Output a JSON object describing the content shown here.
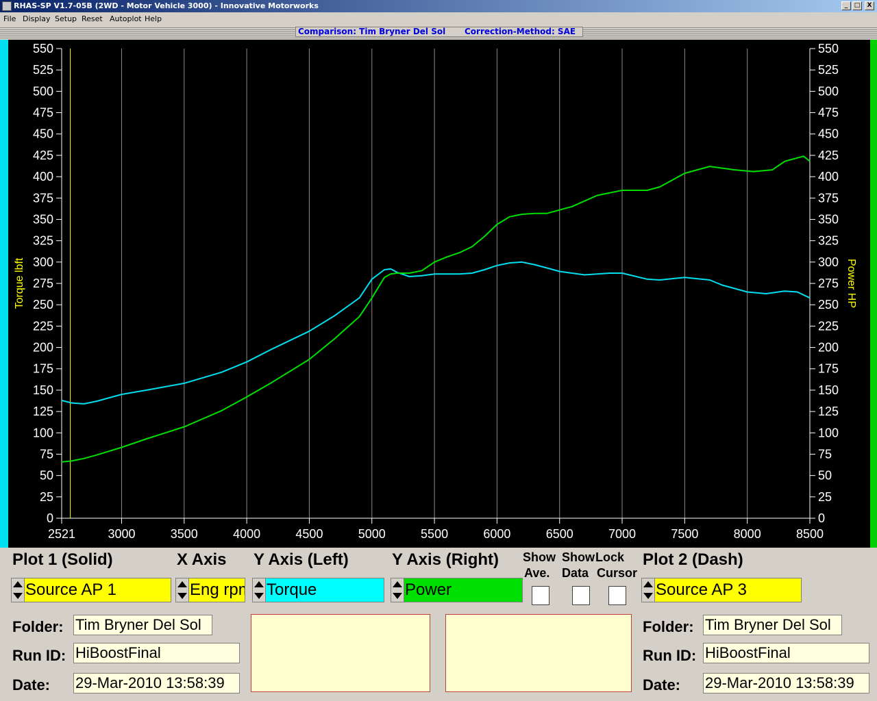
{
  "window": {
    "title": "RHAS-SP V1.7-05B  (2WD - Motor Vehicle 3000) - Innovative Motorworks",
    "controls": [
      "_",
      "□",
      "X"
    ]
  },
  "menu": [
    "File",
    "Display",
    "Setup",
    "Reset",
    "Autoplot",
    "Help"
  ],
  "header": {
    "comparison": "Comparison: Tim Bryner Del Sol",
    "correction": "Correction-Method: SAE"
  },
  "chart_data": {
    "type": "line",
    "xlabel": "",
    "ylabel_left": "Torque lbft",
    "ylabel_right": "Power HP",
    "xlim": [
      2521,
      8500
    ],
    "ylim": [
      0,
      550
    ],
    "x_ticks": [
      "2521",
      "3000",
      "3500",
      "4000",
      "4500",
      "5000",
      "5500",
      "6000",
      "6500",
      "7000",
      "7500",
      "8000",
      "8500"
    ],
    "y_ticks": [
      "0",
      "25",
      "50",
      "75",
      "100",
      "125",
      "150",
      "175",
      "200",
      "225",
      "250",
      "275",
      "300",
      "325",
      "350",
      "375",
      "400",
      "425",
      "450",
      "475",
      "500",
      "525",
      "550"
    ],
    "grid": true,
    "cursor_x": 2590,
    "series": [
      {
        "name": "Torque",
        "color": "#00e0f0",
        "x": [
          2521,
          2600,
          2700,
          2800,
          3000,
          3200,
          3500,
          3800,
          4000,
          4200,
          4500,
          4700,
          4900,
          5000,
          5100,
          5150,
          5200,
          5300,
          5400,
          5500,
          5600,
          5700,
          5800,
          5900,
          6000,
          6100,
          6200,
          6300,
          6400,
          6500,
          6700,
          6900,
          7000,
          7200,
          7300,
          7500,
          7700,
          7800,
          8000,
          8150,
          8300,
          8400,
          8500
        ],
        "values": [
          138,
          135,
          134,
          137,
          145,
          150,
          158,
          171,
          183,
          198,
          219,
          237,
          258,
          280,
          291,
          292,
          288,
          283,
          284,
          286,
          286,
          286,
          287,
          291,
          296,
          299,
          300,
          297,
          293,
          289,
          285,
          287,
          287,
          280,
          279,
          282,
          279,
          273,
          265,
          263,
          266,
          265,
          258
        ]
      },
      {
        "name": "Power",
        "color": "#00e000",
        "x": [
          2521,
          2600,
          2700,
          2800,
          3000,
          3200,
          3500,
          3800,
          4000,
          4200,
          4500,
          4700,
          4900,
          5000,
          5100,
          5150,
          5200,
          5300,
          5400,
          5500,
          5600,
          5700,
          5800,
          5900,
          6000,
          6100,
          6200,
          6300,
          6400,
          6600,
          6800,
          7000,
          7200,
          7300,
          7500,
          7700,
          7900,
          8050,
          8200,
          8300,
          8450,
          8500
        ],
        "values": [
          66,
          67,
          70,
          74,
          83,
          93,
          107,
          126,
          142,
          159,
          186,
          210,
          236,
          258,
          282,
          286,
          287,
          287,
          290,
          300,
          306,
          311,
          318,
          330,
          344,
          353,
          356,
          357,
          357,
          365,
          378,
          384,
          384,
          388,
          404,
          412,
          408,
          406,
          408,
          418,
          424,
          418
        ]
      }
    ]
  },
  "controls": {
    "plot1_label": "Plot 1 (Solid)",
    "xaxis_label": "X Axis",
    "yleft_label": "Y Axis (Left)",
    "yright_label": "Y Axis (Right)",
    "show_ave_line1": "Show",
    "show_ave_line2": "Ave.",
    "show_data_line1": "Show",
    "show_data_line2": "Data",
    "lock_cursor_line1": "Lock",
    "lock_cursor_line2": "Cursor",
    "plot2_label": "Plot 2 (Dash)",
    "plot1_source": "Source AP 1",
    "xaxis_value": "Eng rpm",
    "yleft_value": "Torque",
    "yright_value": "Power",
    "plot2_source": "Source AP 3",
    "colors": {
      "yellow": "#ffff00",
      "cyan": "#00ffff",
      "green": "#00e000"
    }
  },
  "left_info": {
    "folder_label": "Folder:",
    "folder_value": "Tim Bryner Del Sol",
    "runid_label": "Run ID:",
    "runid_value": "HiBoostFinal",
    "date_label": "Date:",
    "date_value": "29-Mar-2010  13:58:39"
  },
  "right_info": {
    "folder_label": "Folder:",
    "folder_value": "Tim Bryner Del Sol",
    "runid_label": "Run ID:",
    "runid_value": "HiBoostFinal",
    "date_label": "Date:",
    "date_value": "29-Mar-2010  13:58:39"
  }
}
